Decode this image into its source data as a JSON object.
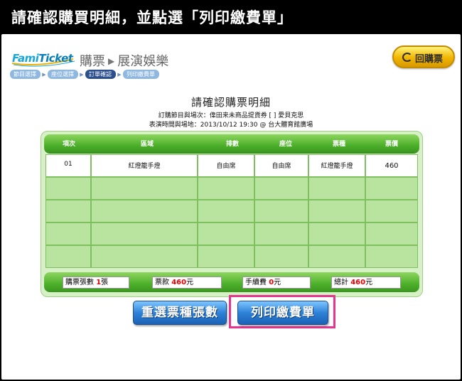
{
  "banner": {
    "text": "請確認購買明細，並點選「列印繳費單」"
  },
  "header": {
    "logo_text_a": "Fami",
    "logo_text_b": "Ticket",
    "section_a": "購票",
    "section_b": "展演娛樂",
    "back_button": "回購票",
    "steps": [
      {
        "label": "節目選擇",
        "active": false
      },
      {
        "label": "座位選擇",
        "active": false
      },
      {
        "label": "訂單確認",
        "active": true
      },
      {
        "label": "列印繳費單",
        "active": false
      }
    ]
  },
  "page": {
    "title": "請確認購票明細",
    "info_line1": "訂購節目與場次：偉田来未商品提貨券 [      ] 愛貝克思",
    "info_line2": "表演時間與場地：2013/10/12 19:30 @ 台大體育館廣場"
  },
  "table": {
    "headers": [
      "項次",
      "區域",
      "排數",
      "座位",
      "票種",
      "票價"
    ],
    "rows": [
      [
        "01",
        "紅燈籠手燈",
        "自由席",
        "自由席",
        "紅燈籠手燈",
        "460"
      ],
      [
        "",
        "",
        "",
        "",
        "",
        ""
      ],
      [
        "",
        "",
        "",
        "",
        "",
        ""
      ],
      [
        "",
        "",
        "",
        "",
        "",
        ""
      ],
      [
        "",
        "",
        "",
        "",
        "",
        ""
      ]
    ]
  },
  "summary": {
    "ticket_count_label": "購票張數",
    "ticket_count_value": "1",
    "ticket_count_unit": "張",
    "price_label": "票款",
    "price_value": "460",
    "price_unit": "元",
    "fee_label": "手續費",
    "fee_value": "0",
    "fee_unit": "元",
    "total_label": "總計",
    "total_value": "460",
    "total_unit": "元"
  },
  "buttons": {
    "reselect": "重選票種張數",
    "print": "列印繳費單"
  },
  "colors": {
    "highlight": "#e6358f",
    "table_green": "#4caf2a",
    "button_blue": "#2e82d8",
    "back_yellow": "#f0b400"
  }
}
